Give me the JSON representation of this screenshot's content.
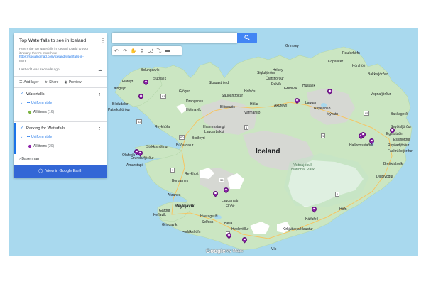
{
  "panel": {
    "title": "Top Waterfalls to see in Iceland",
    "description": "Here's the top waterfalls in Iceland to add to your itinerary, there's more here",
    "link": "https://socialnomad.com/iceland/waterfalls-in-",
    "more": "more",
    "last_edit": "Last edit was seconds ago",
    "actions": {
      "add_layer": "Add layer",
      "share": "Share",
      "preview": "Preview"
    },
    "layers": [
      {
        "name": "Waterfalls",
        "style": "Uniform style",
        "all_items": "All items",
        "count": "(16)",
        "pin_color": "#7cb342"
      },
      {
        "name": "Parking for Waterfalls",
        "style": "Uniform style",
        "all_items": "All items",
        "count": "(20)",
        "pin_color": "#8e24aa"
      }
    ],
    "base_map": "Base map",
    "earth_button": "View in Google Earth"
  },
  "search": {
    "placeholder": ""
  },
  "toolbar": {
    "icons": [
      "undo-icon",
      "redo-icon",
      "hand-icon",
      "marker-icon",
      "line-icon",
      "directions-icon",
      "ruler-icon"
    ]
  },
  "map": {
    "country_label": "Iceland",
    "park_label": "Vatnajökull\nNational Park",
    "capital": "Reykjavík",
    "places": [
      "Grímsey",
      "Raufarhöfn",
      "Þórshöfn",
      "Siglufjörður",
      "Ólafsfjörður",
      "Dalvík",
      "Húsavík",
      "Laugar",
      "Reykjahlíð",
      "Bakkagerði",
      "Egilsstaðir",
      "Seyðisfjörður",
      "Hallormsstaður",
      "Reyðarfjörður",
      "Eskifjörður",
      "Fáskrúðsfjörður",
      "Breiðdalsvík",
      "Djúpivogur",
      "Höfn",
      "Skagaströnd",
      "Sauðárkrókur",
      "Blönduós",
      "Hofsós",
      "Varmahlíð",
      "Hólar",
      "Hvammstangi",
      "Laugarbakki",
      "Borðeyri",
      "Búðardalur",
      "Stykkishólmur",
      "Grundarfjörður",
      "Ólafsvík",
      "Arnarstapi",
      "Borgarnes",
      "Reykholt",
      "Akranes",
      "Laugarvatn",
      "Flúðir",
      "Hveragerði",
      "Selfoss",
      "Hella",
      "Hvolsvöllur",
      "Vík",
      "Kirkjubæjarklaustur",
      "Kálfafell",
      "Garður",
      "Keflavík",
      "Grindavík",
      "Þorlákshöfn",
      "Flateyri",
      "Þingeyri",
      "Bíldudalur",
      "Patreksfjörður",
      "Bolungarvík",
      "Súðavík",
      "Hólmavík",
      "Drangsnes",
      "Reykhólar",
      "Gjögur",
      "Akureyri",
      "Hrísey",
      "Grenivík",
      "Kópasker",
      "Bakkafjörður",
      "Vopnafjörður",
      "Mývatn"
    ],
    "attribution": "Google",
    "mymaps": "My Maps"
  },
  "colors": {
    "water": "#a9d9ee",
    "land": "#cbe6c2",
    "glacier": "#ffffff",
    "accent": "#1a73e8",
    "pin": "#8e24aa",
    "button": "#3367d6"
  }
}
